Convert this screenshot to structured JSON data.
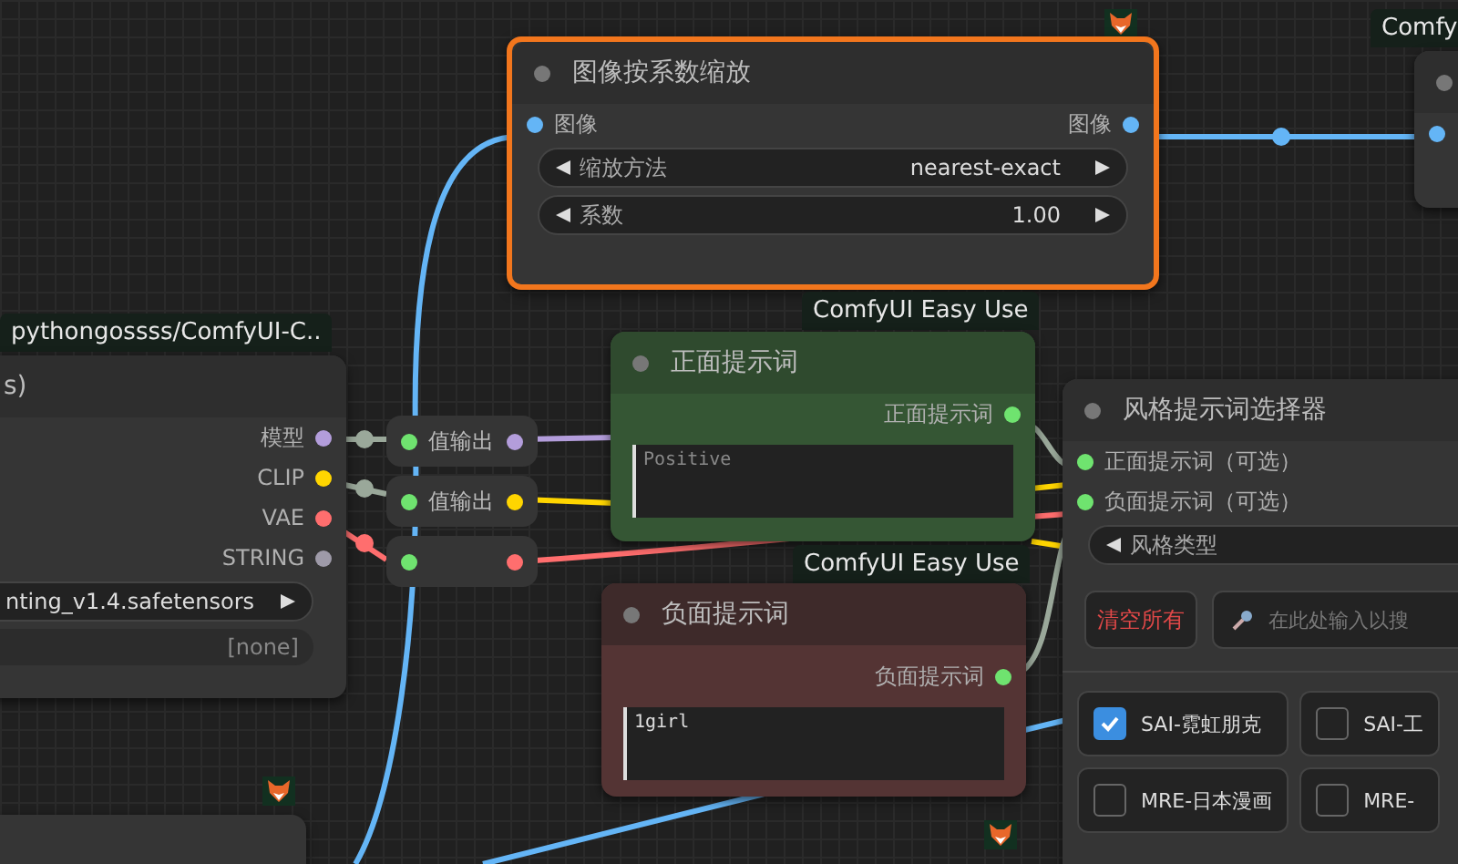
{
  "scale_node": {
    "title": "图像按系数缩放",
    "selected": true,
    "input": "图像",
    "output": "图像",
    "widgets": [
      {
        "label": "缩放方法",
        "value": "nearest-exact"
      },
      {
        "label": "系数",
        "value": "1.00"
      }
    ]
  },
  "top_right_node": {
    "badge": "Comfy"
  },
  "loader_node": {
    "badge": "pythongossss/ComfyUI-C..",
    "title": "s)",
    "outputs": [
      {
        "label": "模型",
        "color": "#b39ddb"
      },
      {
        "label": "CLIP",
        "color": "#ffd500"
      },
      {
        "label": "VAE",
        "color": "#ff6e6e"
      },
      {
        "label": "STRING",
        "color": "#9e9aa8"
      }
    ],
    "widgets": [
      {
        "kind": "combo",
        "value": "nting_v1.4.safetensors"
      },
      {
        "kind": "text",
        "value": "[none]"
      }
    ]
  },
  "reroutes": [
    {
      "label": "值输出",
      "color": "#b39ddb"
    },
    {
      "label": "值输出",
      "color": "#ffd500"
    },
    {
      "color": "#ff6e6e"
    }
  ],
  "positive_node": {
    "badge": "ComfyUI Easy Use",
    "title": "正面提示词",
    "output": "正面提示词",
    "placeholder": "Positive"
  },
  "negative_node": {
    "badge": "ComfyUI Easy Use",
    "title": "负面提示词",
    "output": "负面提示词",
    "value": "1girl"
  },
  "style_node": {
    "title": "风格提示词选择器",
    "inputs": [
      "正面提示词（可选）",
      "负面提示词（可选）"
    ],
    "combo": "风格类型",
    "clear_button": "清空所有",
    "search_placeholder": "在此处输入以搜",
    "styles": [
      {
        "label": "SAI-霓虹朋克",
        "checked": true
      },
      {
        "label": "SAI-工",
        "checked": false
      },
      {
        "label": "MRE-日本漫画",
        "checked": false
      },
      {
        "label": "MRE-",
        "checked": false
      }
    ]
  }
}
